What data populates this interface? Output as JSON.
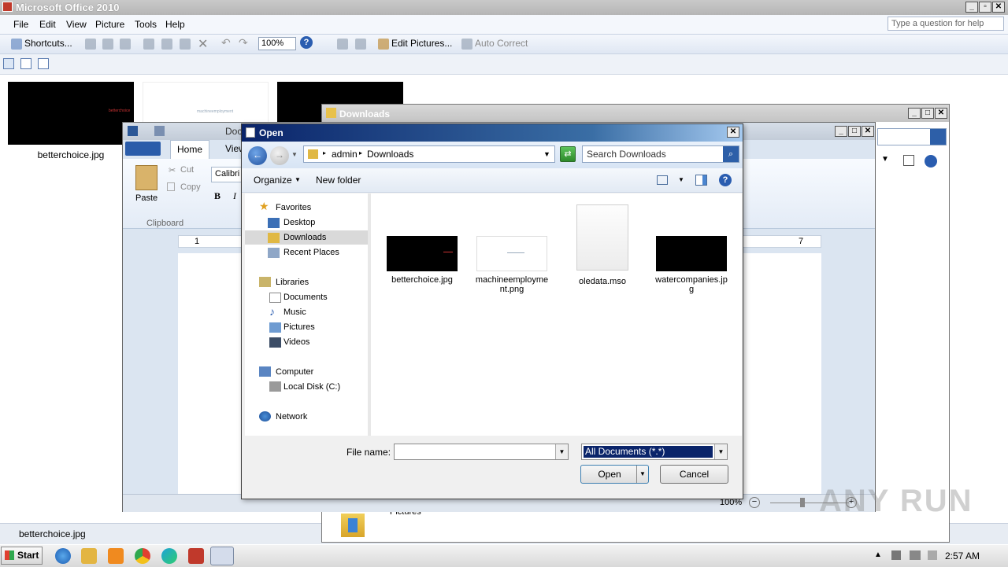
{
  "picture_manager": {
    "title": "Microsoft Office 2010",
    "menu": [
      "File",
      "Edit",
      "View",
      "Picture",
      "Tools",
      "Help"
    ],
    "help_placeholder": "Type a question for help",
    "toolbar": {
      "shortcuts": "Shortcuts...",
      "zoom": "100%",
      "edit_pictures": "Edit Pictures...",
      "auto_correct": "Auto Correct"
    },
    "thumb_labels": [
      "betterchoice.jpg"
    ],
    "thumb_texts": [
      "betterchoice",
      "machineemployment"
    ],
    "status_filename": "betterchoice.jpg"
  },
  "downloads_window": {
    "title": "Downloads",
    "bottom_label": "Pictures"
  },
  "word_window": {
    "title_fragment": "Doc",
    "tabs": [
      "Home",
      "View"
    ],
    "clipboard": {
      "paste": "Paste",
      "cut": "Cut",
      "copy": "Copy",
      "group": "Clipboard"
    },
    "font_name": "Calibri",
    "bold": "B",
    "italic": "I",
    "ruler_left": "1",
    "ruler_right": "7",
    "zoom": "100%"
  },
  "open_dialog": {
    "title": "Open",
    "path": [
      "admin",
      "Downloads"
    ],
    "search_placeholder": "Search Downloads",
    "organize": "Organize",
    "new_folder": "New folder",
    "nav": {
      "favorites": "Favorites",
      "desktop": "Desktop",
      "downloads": "Downloads",
      "recent": "Recent Places",
      "libraries": "Libraries",
      "documents": "Documents",
      "music": "Music",
      "pictures": "Pictures",
      "videos": "Videos",
      "computer": "Computer",
      "local_disk": "Local Disk (C:)",
      "network": "Network"
    },
    "files": [
      {
        "name": "betterchoice.jpg"
      },
      {
        "name": "machineemployment.png"
      },
      {
        "name": "oledata.mso"
      },
      {
        "name": "watercompanies.jpg"
      }
    ],
    "file_name_label": "File name:",
    "file_name_value": "",
    "file_type": "All Documents (*.*)",
    "open_button": "Open",
    "cancel_button": "Cancel"
  },
  "taskbar": {
    "start": "Start",
    "clock": "2:57 AM"
  },
  "watermark": "ANY RUN"
}
